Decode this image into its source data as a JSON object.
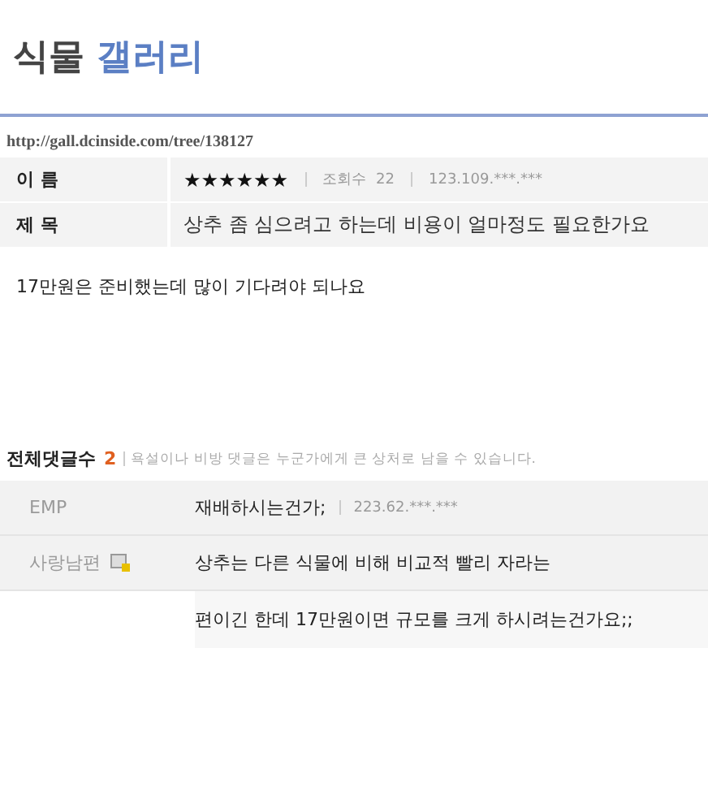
{
  "gallery_title": {
    "prefix": "식물",
    "name": "갤러리"
  },
  "url": "http://gall.dcinside.com/tree/138127",
  "post": {
    "name_label": "이 름",
    "author": "★★★★★★",
    "views_label": "조회수",
    "views": "22",
    "ip": "123.109.***.***",
    "subject_label": "제 목",
    "subject": "상추 좀 심으려고 하는데 비용이 얼마정도 필요한가요"
  },
  "body": "17만원은 준비했는데 많이 기다려야 되나요",
  "comments_header": {
    "label": "전체댓글수",
    "count": "2",
    "notice": "욕설이나 비방 댓글은 누군가에게 큰 상처로 남을 수 있습니다."
  },
  "comments": [
    {
      "author": "EMP",
      "text": "재배하시는건가;",
      "ip": "223.62.***.***",
      "gallog_icon": false
    },
    {
      "author": "사랑남편",
      "text": "상추는 다른 식물에 비해 비교적 빨리 자라는",
      "gallog_icon": true,
      "continuation": "편이긴 한데 17만원이면 규모를 크게 하시려는건가요;;"
    }
  ]
}
